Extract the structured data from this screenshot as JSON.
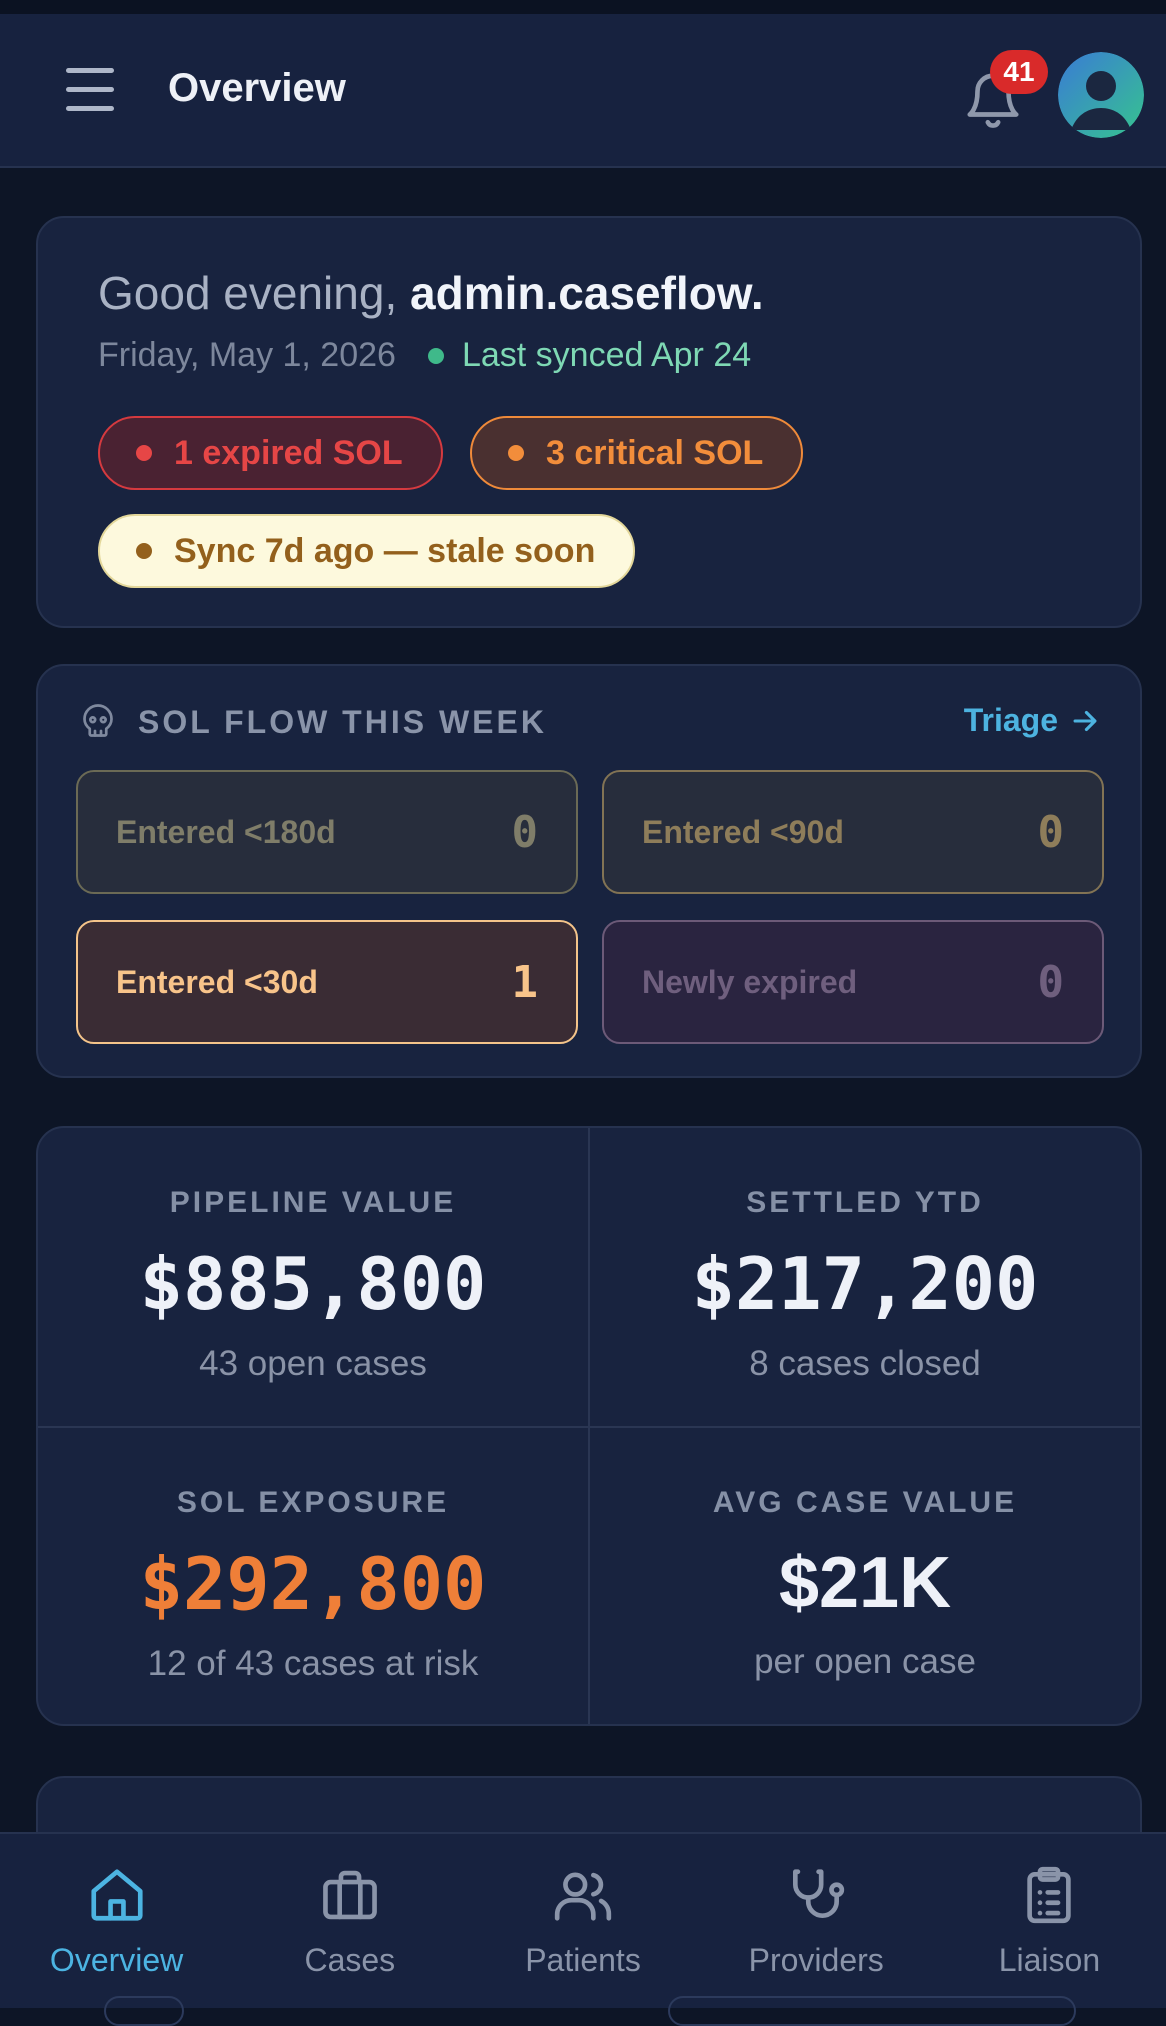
{
  "header": {
    "title": "Overview",
    "notification_count": "41"
  },
  "greeting": {
    "prefix": "Good evening, ",
    "username": "admin.caseflow.",
    "date": "Friday, May 1, 2026",
    "sync_status": "Last synced Apr 24",
    "pills": [
      {
        "label": "1 expired SOL",
        "color": "#e64646"
      },
      {
        "label": "3 critical SOL",
        "color": "#f28d3b"
      },
      {
        "label": "Sync 7d ago — stale soon",
        "color": "#93601c"
      }
    ]
  },
  "sol_flow": {
    "title": "SOL FLOW THIS WEEK",
    "action_label": "Triage",
    "tiles": [
      {
        "label": "Entered <180d",
        "value": "0"
      },
      {
        "label": "Entered <90d",
        "value": "0"
      },
      {
        "label": "Entered <30d",
        "value": "1"
      },
      {
        "label": "Newly expired",
        "value": "0"
      }
    ]
  },
  "metrics": [
    {
      "label": "PIPELINE VALUE",
      "value": "$885,800",
      "sub": "43 open cases"
    },
    {
      "label": "SETTLED YTD",
      "value": "$217,200",
      "sub": "8 cases closed"
    },
    {
      "label": "SOL EXPOSURE",
      "value": "$292,800",
      "sub": "12 of 43 cases at risk",
      "color": "#ef7f38"
    },
    {
      "label": "AVG CASE VALUE",
      "value": "$21K",
      "sub": "per open case"
    }
  ],
  "nav": {
    "items": [
      {
        "label": "Overview",
        "icon": "home-icon",
        "active": true
      },
      {
        "label": "Cases",
        "icon": "briefcase-icon"
      },
      {
        "label": "Patients",
        "icon": "users-icon"
      },
      {
        "label": "Providers",
        "icon": "stethoscope-icon"
      },
      {
        "label": "Liaison",
        "icon": "clipboard-icon"
      }
    ],
    "accent": "#4cb4e2"
  }
}
